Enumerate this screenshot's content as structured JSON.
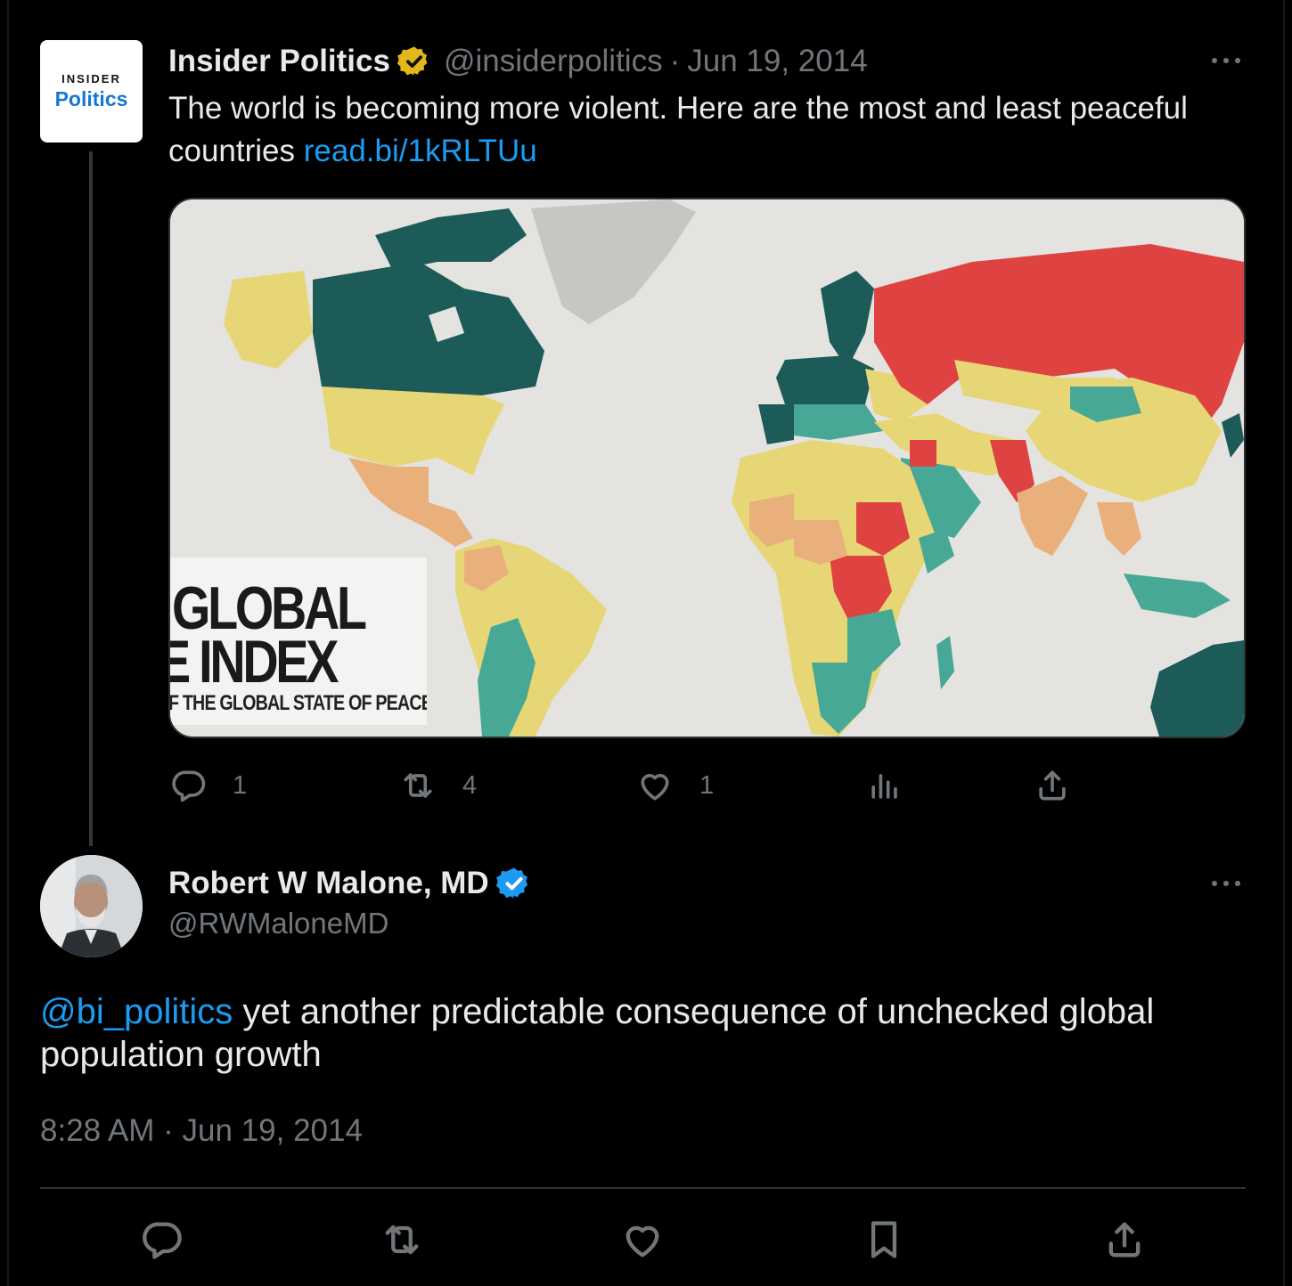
{
  "parent_tweet": {
    "avatar": {
      "top_text": "INSIDER",
      "bottom_text": "Politics"
    },
    "author_name": "Insider Politics",
    "handle": "@insiderpolitics",
    "separator": "·",
    "date": "Jun 19, 2014",
    "text": "The world is becoming more violent. Here are the most and least peaceful countries ",
    "link": "read.bi/1kRLTUu",
    "media": {
      "overlay_line1": "GLOBAL",
      "overlay_line2": "E INDEX",
      "overlay_line3": "F THE GLOBAL STATE OF PEACE",
      "colors": {
        "very_high": "#1c5b57",
        "high": "#46a895",
        "medium": "#e6d675",
        "low": "#e9b07c",
        "very_low": "#de4342",
        "not_included": "#c8c6c2",
        "background": "#e4e3df"
      }
    },
    "actions": {
      "replies": "1",
      "reposts": "4",
      "likes": "1"
    },
    "icons": [
      "reply-icon",
      "repost-icon",
      "like-icon",
      "views-icon",
      "share-icon",
      "more-icon",
      "verified-gold-icon"
    ]
  },
  "reply_tweet": {
    "author_name": "Robert W Malone, MD",
    "handle": "@RWMaloneMD",
    "mention": "@bi_politics",
    "text": " yet another predictable consequence of unchecked global population growth",
    "time": "8:28 AM",
    "separator": "·",
    "date": "Jun 19, 2014",
    "icons": [
      "reply-icon",
      "repost-icon",
      "like-icon",
      "bookmark-icon",
      "share-icon",
      "more-icon",
      "verified-blue-icon"
    ]
  },
  "colors": {
    "background": "#000000",
    "text": "#e7e9ea",
    "muted": "#71767b",
    "link": "#1d9bf0",
    "divider": "#2f3336",
    "gold_badge": "#e2b719",
    "blue_badge": "#1d9bf0"
  }
}
